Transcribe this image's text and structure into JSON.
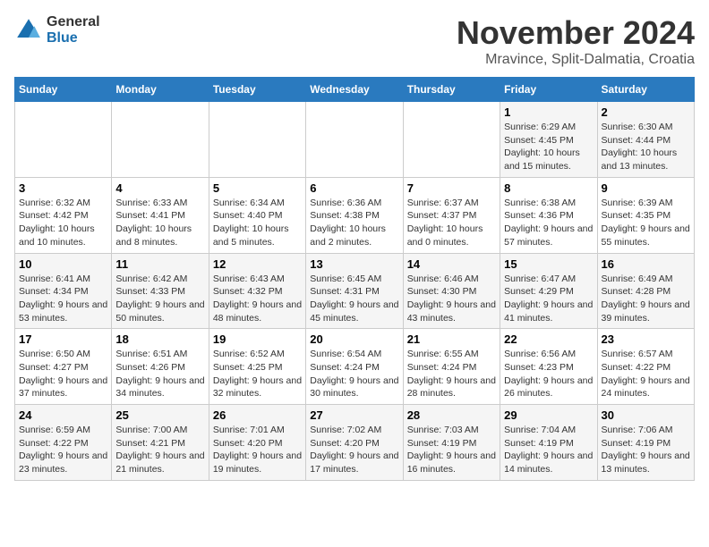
{
  "logo": {
    "general": "General",
    "blue": "Blue"
  },
  "title": "November 2024",
  "subtitle": "Mravince, Split-Dalmatia, Croatia",
  "headers": [
    "Sunday",
    "Monday",
    "Tuesday",
    "Wednesday",
    "Thursday",
    "Friday",
    "Saturday"
  ],
  "weeks": [
    [
      {
        "day": "",
        "info": ""
      },
      {
        "day": "",
        "info": ""
      },
      {
        "day": "",
        "info": ""
      },
      {
        "day": "",
        "info": ""
      },
      {
        "day": "",
        "info": ""
      },
      {
        "day": "1",
        "info": "Sunrise: 6:29 AM\nSunset: 4:45 PM\nDaylight: 10 hours and 15 minutes."
      },
      {
        "day": "2",
        "info": "Sunrise: 6:30 AM\nSunset: 4:44 PM\nDaylight: 10 hours and 13 minutes."
      }
    ],
    [
      {
        "day": "3",
        "info": "Sunrise: 6:32 AM\nSunset: 4:42 PM\nDaylight: 10 hours and 10 minutes."
      },
      {
        "day": "4",
        "info": "Sunrise: 6:33 AM\nSunset: 4:41 PM\nDaylight: 10 hours and 8 minutes."
      },
      {
        "day": "5",
        "info": "Sunrise: 6:34 AM\nSunset: 4:40 PM\nDaylight: 10 hours and 5 minutes."
      },
      {
        "day": "6",
        "info": "Sunrise: 6:36 AM\nSunset: 4:38 PM\nDaylight: 10 hours and 2 minutes."
      },
      {
        "day": "7",
        "info": "Sunrise: 6:37 AM\nSunset: 4:37 PM\nDaylight: 10 hours and 0 minutes."
      },
      {
        "day": "8",
        "info": "Sunrise: 6:38 AM\nSunset: 4:36 PM\nDaylight: 9 hours and 57 minutes."
      },
      {
        "day": "9",
        "info": "Sunrise: 6:39 AM\nSunset: 4:35 PM\nDaylight: 9 hours and 55 minutes."
      }
    ],
    [
      {
        "day": "10",
        "info": "Sunrise: 6:41 AM\nSunset: 4:34 PM\nDaylight: 9 hours and 53 minutes."
      },
      {
        "day": "11",
        "info": "Sunrise: 6:42 AM\nSunset: 4:33 PM\nDaylight: 9 hours and 50 minutes."
      },
      {
        "day": "12",
        "info": "Sunrise: 6:43 AM\nSunset: 4:32 PM\nDaylight: 9 hours and 48 minutes."
      },
      {
        "day": "13",
        "info": "Sunrise: 6:45 AM\nSunset: 4:31 PM\nDaylight: 9 hours and 45 minutes."
      },
      {
        "day": "14",
        "info": "Sunrise: 6:46 AM\nSunset: 4:30 PM\nDaylight: 9 hours and 43 minutes."
      },
      {
        "day": "15",
        "info": "Sunrise: 6:47 AM\nSunset: 4:29 PM\nDaylight: 9 hours and 41 minutes."
      },
      {
        "day": "16",
        "info": "Sunrise: 6:49 AM\nSunset: 4:28 PM\nDaylight: 9 hours and 39 minutes."
      }
    ],
    [
      {
        "day": "17",
        "info": "Sunrise: 6:50 AM\nSunset: 4:27 PM\nDaylight: 9 hours and 37 minutes."
      },
      {
        "day": "18",
        "info": "Sunrise: 6:51 AM\nSunset: 4:26 PM\nDaylight: 9 hours and 34 minutes."
      },
      {
        "day": "19",
        "info": "Sunrise: 6:52 AM\nSunset: 4:25 PM\nDaylight: 9 hours and 32 minutes."
      },
      {
        "day": "20",
        "info": "Sunrise: 6:54 AM\nSunset: 4:24 PM\nDaylight: 9 hours and 30 minutes."
      },
      {
        "day": "21",
        "info": "Sunrise: 6:55 AM\nSunset: 4:24 PM\nDaylight: 9 hours and 28 minutes."
      },
      {
        "day": "22",
        "info": "Sunrise: 6:56 AM\nSunset: 4:23 PM\nDaylight: 9 hours and 26 minutes."
      },
      {
        "day": "23",
        "info": "Sunrise: 6:57 AM\nSunset: 4:22 PM\nDaylight: 9 hours and 24 minutes."
      }
    ],
    [
      {
        "day": "24",
        "info": "Sunrise: 6:59 AM\nSunset: 4:22 PM\nDaylight: 9 hours and 23 minutes."
      },
      {
        "day": "25",
        "info": "Sunrise: 7:00 AM\nSunset: 4:21 PM\nDaylight: 9 hours and 21 minutes."
      },
      {
        "day": "26",
        "info": "Sunrise: 7:01 AM\nSunset: 4:20 PM\nDaylight: 9 hours and 19 minutes."
      },
      {
        "day": "27",
        "info": "Sunrise: 7:02 AM\nSunset: 4:20 PM\nDaylight: 9 hours and 17 minutes."
      },
      {
        "day": "28",
        "info": "Sunrise: 7:03 AM\nSunset: 4:19 PM\nDaylight: 9 hours and 16 minutes."
      },
      {
        "day": "29",
        "info": "Sunrise: 7:04 AM\nSunset: 4:19 PM\nDaylight: 9 hours and 14 minutes."
      },
      {
        "day": "30",
        "info": "Sunrise: 7:06 AM\nSunset: 4:19 PM\nDaylight: 9 hours and 13 minutes."
      }
    ]
  ]
}
